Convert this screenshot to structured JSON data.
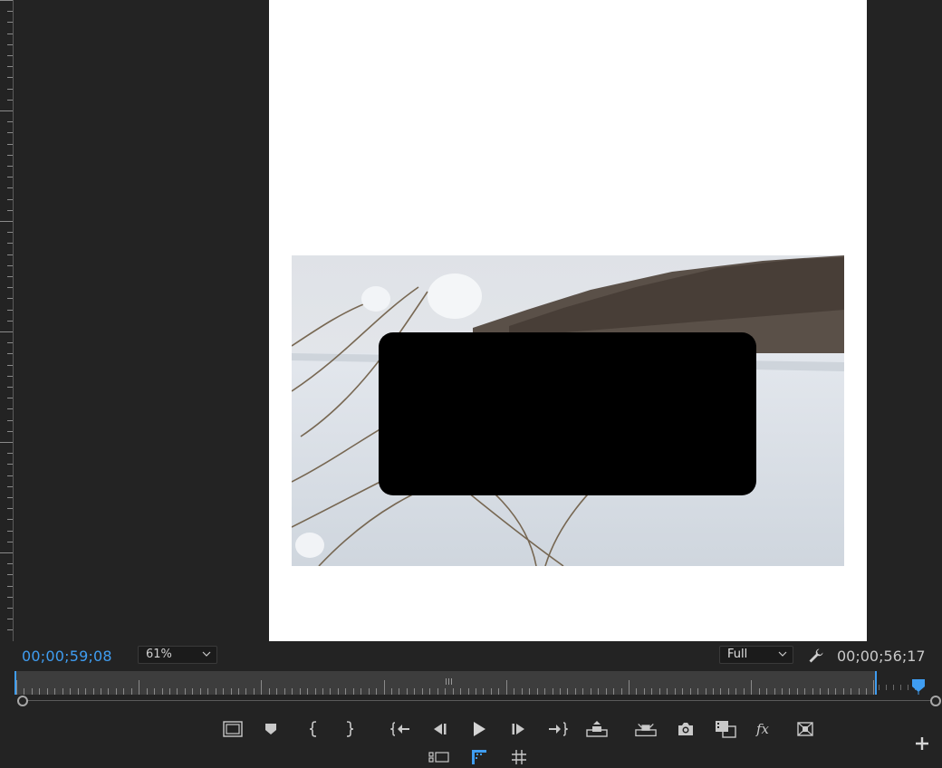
{
  "playback": {
    "current_timecode": "00;00;59;08",
    "duration_timecode": "00;00;56;17",
    "zoom_level": "61%",
    "playback_resolution": "Full"
  },
  "colors": {
    "accent": "#3f9df1",
    "panel_bg": "#232323",
    "canvas_bg": "#ffffff"
  },
  "transport_buttons": [
    "safe-margins-icon",
    "add-marker-icon",
    "mark-in-icon",
    "mark-out-icon",
    "go-to-in-icon",
    "step-back-icon",
    "play-icon",
    "step-forward-icon",
    "go-to-out-icon",
    "lift-icon",
    "extract-icon",
    "export-frame-icon",
    "comparison-view-icon",
    "toggle-proxies-icon",
    "multi-camera-icon"
  ],
  "secondary_buttons": [
    "settings-layout-icon",
    "guides-icon",
    "grid-icon"
  ]
}
